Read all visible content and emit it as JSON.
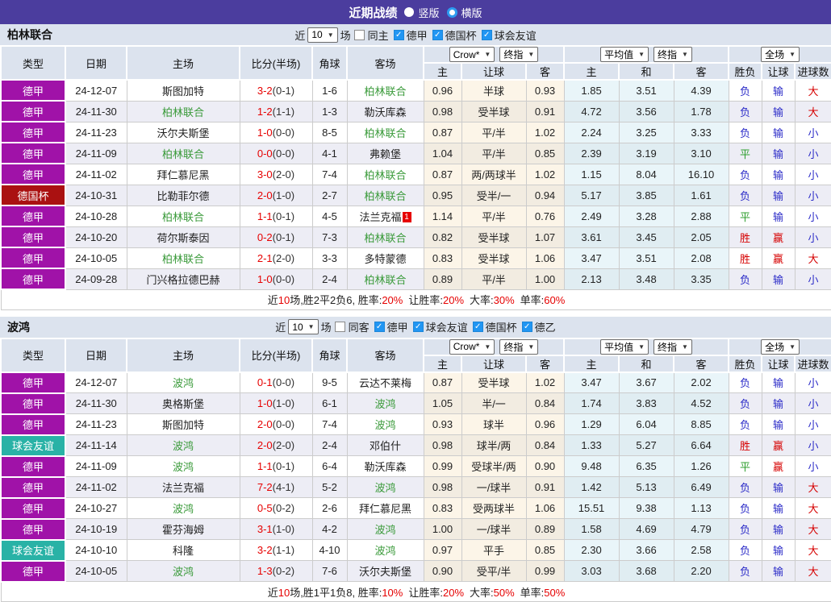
{
  "topbar": {
    "title": "近期战绩",
    "radio_vertical": "竖版",
    "radio_horizontal": "横版"
  },
  "columns": {
    "type": "类型",
    "date": "日期",
    "home": "主场",
    "score": "比分(半场)",
    "corner": "角球",
    "away": "客场",
    "odds_home": "主",
    "odds_handicap": "让球",
    "odds_away": "客",
    "avg_home": "主",
    "avg_draw": "和",
    "avg_away": "客",
    "result": "胜负",
    "result_handicap": "让球",
    "goals": "进球数"
  },
  "dropdowns": {
    "crow": "Crow*",
    "final": "终指",
    "avg": "平均值",
    "final2": "终指",
    "full": "全场"
  },
  "sections": [
    {
      "team": "柏林联合",
      "filter": {
        "near": "近",
        "count": "10",
        "games": "场",
        "same": "同主",
        "leagues": [
          "德甲",
          "德国杯",
          "球会友谊"
        ]
      },
      "rows": [
        {
          "t": "德甲",
          "d": "24-12-07",
          "h": "斯图加特",
          "hg": false,
          "ft": "3-2",
          "ht": "(0-1)",
          "c": "1-6",
          "a": "柏林联合",
          "ag": true,
          "b": "",
          "o1": "0.96",
          "o2": "半球",
          "o3": "0.93",
          "a1": "1.85",
          "a2": "3.51",
          "a3": "4.39",
          "r1": "负",
          "r2": "输",
          "r3": "大"
        },
        {
          "t": "德甲",
          "d": "24-11-30",
          "h": "柏林联合",
          "hg": true,
          "ft": "1-2",
          "ht": "(1-1)",
          "c": "1-3",
          "a": "勒沃库森",
          "ag": false,
          "b": "",
          "o1": "0.98",
          "o2": "受半球",
          "o3": "0.91",
          "a1": "4.72",
          "a2": "3.56",
          "a3": "1.78",
          "r1": "负",
          "r2": "输",
          "r3": "大"
        },
        {
          "t": "德甲",
          "d": "24-11-23",
          "h": "沃尔夫斯堡",
          "hg": false,
          "ft": "1-0",
          "ht": "(0-0)",
          "c": "8-5",
          "a": "柏林联合",
          "ag": true,
          "b": "",
          "o1": "0.87",
          "o2": "平/半",
          "o3": "1.02",
          "a1": "2.24",
          "a2": "3.25",
          "a3": "3.33",
          "r1": "负",
          "r2": "输",
          "r3": "小"
        },
        {
          "t": "德甲",
          "d": "24-11-09",
          "h": "柏林联合",
          "hg": true,
          "ft": "0-0",
          "ht": "(0-0)",
          "c": "4-1",
          "a": "弗赖堡",
          "ag": false,
          "b": "",
          "o1": "1.04",
          "o2": "平/半",
          "o3": "0.85",
          "a1": "2.39",
          "a2": "3.19",
          "a3": "3.10",
          "r1": "平",
          "r2": "输",
          "r3": "小"
        },
        {
          "t": "德甲",
          "d": "24-11-02",
          "h": "拜仁慕尼黑",
          "hg": false,
          "ft": "3-0",
          "ht": "(2-0)",
          "c": "7-4",
          "a": "柏林联合",
          "ag": true,
          "b": "",
          "o1": "0.87",
          "o2": "两/两球半",
          "o3": "1.02",
          "a1": "1.15",
          "a2": "8.04",
          "a3": "16.10",
          "r1": "负",
          "r2": "输",
          "r3": "小"
        },
        {
          "t": "德国杯",
          "d": "24-10-31",
          "h": "比勒菲尔德",
          "hg": false,
          "ft": "2-0",
          "ht": "(1-0)",
          "c": "2-7",
          "a": "柏林联合",
          "ag": true,
          "b": "",
          "o1": "0.95",
          "o2": "受半/一",
          "o3": "0.94",
          "a1": "5.17",
          "a2": "3.85",
          "a3": "1.61",
          "r1": "负",
          "r2": "输",
          "r3": "小"
        },
        {
          "t": "德甲",
          "d": "24-10-28",
          "h": "柏林联合",
          "hg": true,
          "ft": "1-1",
          "ht": "(0-1)",
          "c": "4-5",
          "a": "法兰克福",
          "ag": false,
          "b": "1",
          "o1": "1.14",
          "o2": "平/半",
          "o3": "0.76",
          "a1": "2.49",
          "a2": "3.28",
          "a3": "2.88",
          "r1": "平",
          "r2": "输",
          "r3": "小"
        },
        {
          "t": "德甲",
          "d": "24-10-20",
          "h": "荷尔斯泰因",
          "hg": false,
          "ft": "0-2",
          "ht": "(0-1)",
          "c": "7-3",
          "a": "柏林联合",
          "ag": true,
          "b": "",
          "o1": "0.82",
          "o2": "受半球",
          "o3": "1.07",
          "a1": "3.61",
          "a2": "3.45",
          "a3": "2.05",
          "r1": "胜",
          "r2": "赢",
          "r3": "小"
        },
        {
          "t": "德甲",
          "d": "24-10-05",
          "h": "柏林联合",
          "hg": true,
          "ft": "2-1",
          "ht": "(2-0)",
          "c": "3-3",
          "a": "多特蒙德",
          "ag": false,
          "b": "",
          "o1": "0.83",
          "o2": "受半球",
          "o3": "1.06",
          "a1": "3.47",
          "a2": "3.51",
          "a3": "2.08",
          "r1": "胜",
          "r2": "赢",
          "r3": "大"
        },
        {
          "t": "德甲",
          "d": "24-09-28",
          "h": "门兴格拉德巴赫",
          "hg": false,
          "ft": "1-0",
          "ht": "(0-0)",
          "c": "2-4",
          "a": "柏林联合",
          "ag": true,
          "b": "",
          "o1": "0.89",
          "o2": "平/半",
          "o3": "1.00",
          "a1": "2.13",
          "a2": "3.48",
          "a3": "3.35",
          "r1": "负",
          "r2": "输",
          "r3": "小"
        }
      ],
      "summary": {
        "p1": "近",
        "n1": "10",
        "p2": "场,胜2平2负6, 胜率:",
        "n2": "20%",
        "p3": "让胜率:",
        "n3": "20%",
        "p4": "大率:",
        "n4": "30%",
        "p5": "单率:",
        "n5": "60%"
      }
    },
    {
      "team": "波鸿",
      "filter": {
        "near": "近",
        "count": "10",
        "games": "场",
        "same": "同客",
        "leagues": [
          "德甲",
          "球会友谊",
          "德国杯",
          "德乙"
        ]
      },
      "rows": [
        {
          "t": "德甲",
          "d": "24-12-07",
          "h": "波鸿",
          "hg": true,
          "ft": "0-1",
          "ht": "(0-0)",
          "c": "9-5",
          "a": "云达不莱梅",
          "ag": false,
          "b": "",
          "o1": "0.87",
          "o2": "受半球",
          "o3": "1.02",
          "a1": "3.47",
          "a2": "3.67",
          "a3": "2.02",
          "r1": "负",
          "r2": "输",
          "r3": "小"
        },
        {
          "t": "德甲",
          "d": "24-11-30",
          "h": "奥格斯堡",
          "hg": false,
          "ft": "1-0",
          "ht": "(1-0)",
          "c": "6-1",
          "a": "波鸿",
          "ag": true,
          "b": "",
          "o1": "1.05",
          "o2": "半/一",
          "o3": "0.84",
          "a1": "1.74",
          "a2": "3.83",
          "a3": "4.52",
          "r1": "负",
          "r2": "输",
          "r3": "小"
        },
        {
          "t": "德甲",
          "d": "24-11-23",
          "h": "斯图加特",
          "hg": false,
          "ft": "2-0",
          "ht": "(0-0)",
          "c": "7-4",
          "a": "波鸿",
          "ag": true,
          "b": "",
          "o1": "0.93",
          "o2": "球半",
          "o3": "0.96",
          "a1": "1.29",
          "a2": "6.04",
          "a3": "8.85",
          "r1": "负",
          "r2": "输",
          "r3": "小"
        },
        {
          "t": "球会友谊",
          "d": "24-11-14",
          "h": "波鸿",
          "hg": true,
          "ft": "2-0",
          "ht": "(2-0)",
          "c": "2-4",
          "a": "邓伯什",
          "ag": false,
          "b": "",
          "o1": "0.98",
          "o2": "球半/两",
          "o3": "0.84",
          "a1": "1.33",
          "a2": "5.27",
          "a3": "6.64",
          "r1": "胜",
          "r2": "赢",
          "r3": "小"
        },
        {
          "t": "德甲",
          "d": "24-11-09",
          "h": "波鸿",
          "hg": true,
          "ft": "1-1",
          "ht": "(0-1)",
          "c": "6-4",
          "a": "勒沃库森",
          "ag": false,
          "b": "",
          "o1": "0.99",
          "o2": "受球半/两",
          "o3": "0.90",
          "a1": "9.48",
          "a2": "6.35",
          "a3": "1.26",
          "r1": "平",
          "r2": "赢",
          "r3": "小"
        },
        {
          "t": "德甲",
          "d": "24-11-02",
          "h": "法兰克福",
          "hg": false,
          "ft": "7-2",
          "ht": "(4-1)",
          "c": "5-2",
          "a": "波鸿",
          "ag": true,
          "b": "",
          "o1": "0.98",
          "o2": "一/球半",
          "o3": "0.91",
          "a1": "1.42",
          "a2": "5.13",
          "a3": "6.49",
          "r1": "负",
          "r2": "输",
          "r3": "大"
        },
        {
          "t": "德甲",
          "d": "24-10-27",
          "h": "波鸿",
          "hg": true,
          "ft": "0-5",
          "ht": "(0-2)",
          "c": "2-6",
          "a": "拜仁慕尼黑",
          "ag": false,
          "b": "",
          "o1": "0.83",
          "o2": "受两球半",
          "o3": "1.06",
          "a1": "15.51",
          "a2": "9.38",
          "a3": "1.13",
          "r1": "负",
          "r2": "输",
          "r3": "大"
        },
        {
          "t": "德甲",
          "d": "24-10-19",
          "h": "霍芬海姆",
          "hg": false,
          "ft": "3-1",
          "ht": "(1-0)",
          "c": "4-2",
          "a": "波鸿",
          "ag": true,
          "b": "",
          "o1": "1.00",
          "o2": "一/球半",
          "o3": "0.89",
          "a1": "1.58",
          "a2": "4.69",
          "a3": "4.79",
          "r1": "负",
          "r2": "输",
          "r3": "大"
        },
        {
          "t": "球会友谊",
          "d": "24-10-10",
          "h": "科隆",
          "hg": false,
          "ft": "3-2",
          "ht": "(1-1)",
          "c": "4-10",
          "a": "波鸿",
          "ag": true,
          "b": "",
          "o1": "0.97",
          "o2": "平手",
          "o3": "0.85",
          "a1": "2.30",
          "a2": "3.66",
          "a3": "2.58",
          "r1": "负",
          "r2": "输",
          "r3": "大"
        },
        {
          "t": "德甲",
          "d": "24-10-05",
          "h": "波鸿",
          "hg": true,
          "ft": "1-3",
          "ht": "(0-2)",
          "c": "7-6",
          "a": "沃尔夫斯堡",
          "ag": false,
          "b": "",
          "o1": "0.90",
          "o2": "受平/半",
          "o3": "0.99",
          "a1": "3.03",
          "a2": "3.68",
          "a3": "2.20",
          "r1": "负",
          "r2": "输",
          "r3": "大"
        }
      ],
      "summary": {
        "p1": "近",
        "n1": "10",
        "p2": "场,胜1平1负8, 胜率:",
        "n2": "10%",
        "p3": "让胜率:",
        "n3": "20%",
        "p4": "大率:",
        "n4": "50%",
        "p5": "单率:",
        "n5": "50%"
      }
    }
  ]
}
